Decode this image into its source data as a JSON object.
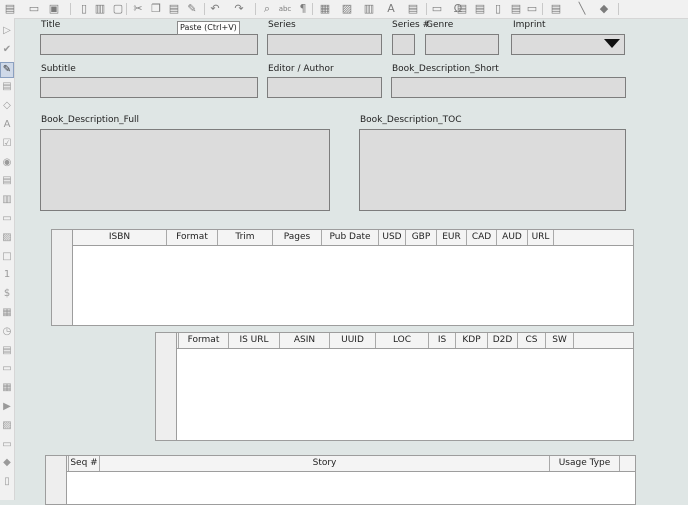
{
  "toolbar": {
    "icons": [
      {
        "name": "new-document-icon",
        "glyph": "▤"
      },
      {
        "name": "open-folder-icon",
        "glyph": "▭"
      },
      {
        "name": "save-icon",
        "glyph": "▣"
      },
      {
        "name": "export-pdf-icon",
        "glyph": "▯"
      },
      {
        "name": "print-icon",
        "glyph": "▥"
      },
      {
        "name": "print-preview-icon",
        "glyph": "▢"
      },
      {
        "name": "cut-icon",
        "glyph": "✂"
      },
      {
        "name": "copy-icon",
        "glyph": "❐"
      },
      {
        "name": "paste-icon",
        "glyph": "▤"
      },
      {
        "name": "clone-formatting-icon",
        "glyph": "✎"
      },
      {
        "name": "undo-icon",
        "glyph": "↶"
      },
      {
        "name": "redo-icon",
        "glyph": "↷"
      },
      {
        "name": "find-replace-icon",
        "glyph": "⌕"
      },
      {
        "name": "spellcheck-icon",
        "glyph": "abc"
      },
      {
        "name": "formatting-marks-icon",
        "glyph": "¶"
      },
      {
        "name": "insert-table-icon",
        "glyph": "▦"
      },
      {
        "name": "insert-image-icon",
        "glyph": "▨"
      },
      {
        "name": "insert-chart-icon",
        "glyph": "▥"
      },
      {
        "name": "insert-textbox-icon",
        "glyph": "A"
      },
      {
        "name": "insert-page-break-icon",
        "glyph": "▤"
      },
      {
        "name": "insert-field-icon",
        "glyph": "▭"
      },
      {
        "name": "special-character-icon",
        "glyph": "Ω"
      },
      {
        "name": "hyperlink-icon",
        "glyph": "⊕"
      },
      {
        "name": "footnote-icon",
        "glyph": "▤"
      },
      {
        "name": "endnote-icon",
        "glyph": "▤"
      },
      {
        "name": "bookmark-icon",
        "glyph": "▯"
      },
      {
        "name": "cross-reference-icon",
        "glyph": "▤"
      },
      {
        "name": "comment-icon",
        "glyph": "▭"
      },
      {
        "name": "track-changes-icon",
        "glyph": "▤"
      },
      {
        "name": "line-icon",
        "glyph": "╲"
      },
      {
        "name": "basic-shapes-icon",
        "glyph": "◆"
      }
    ]
  },
  "tooltip": {
    "text": "Paste (Ctrl+V)"
  },
  "sidebar": {
    "icons": [
      {
        "name": "select-pointer-icon",
        "glyph": "▷"
      },
      {
        "name": "design-mode-icon",
        "glyph": "✔"
      },
      {
        "name": "control-properties-icon",
        "glyph": "✎"
      },
      {
        "name": "form-properties-icon",
        "glyph": "▤"
      },
      {
        "name": "tab-order-icon",
        "glyph": "◇"
      },
      {
        "name": "label-field-icon",
        "glyph": "A"
      },
      {
        "name": "checkbox-icon",
        "glyph": "☑"
      },
      {
        "name": "option-button-icon",
        "glyph": "◉"
      },
      {
        "name": "list-box-icon",
        "glyph": "▤"
      },
      {
        "name": "combo-box-icon",
        "glyph": "▥"
      },
      {
        "name": "push-button-icon",
        "glyph": "▭"
      },
      {
        "name": "image-button-icon",
        "glyph": "▨"
      },
      {
        "name": "formatted-field-icon",
        "glyph": "□"
      },
      {
        "name": "numeric-field-icon",
        "glyph": "1"
      },
      {
        "name": "currency-field-icon",
        "glyph": "$"
      },
      {
        "name": "date-field-icon",
        "glyph": "▦"
      },
      {
        "name": "time-field-icon",
        "glyph": "◷"
      },
      {
        "name": "pattern-field-icon",
        "glyph": "▤"
      },
      {
        "name": "group-box-icon",
        "glyph": "▭"
      },
      {
        "name": "table-control-icon",
        "glyph": "▦"
      },
      {
        "name": "navigation-bar-icon",
        "glyph": "▶"
      },
      {
        "name": "image-control-icon",
        "glyph": "▨"
      },
      {
        "name": "file-selection-icon",
        "glyph": "▭"
      },
      {
        "name": "spin-button-icon",
        "glyph": "◆"
      },
      {
        "name": "scrollbar-icon",
        "glyph": "▯"
      }
    ]
  },
  "form": {
    "labels": {
      "title": "Title",
      "series": "Series",
      "series_num": "Series #",
      "genre": "Genre",
      "imprint": "Imprint",
      "subtitle": "Subtitle",
      "editor_author": "Editor / Author",
      "desc_short": "Book_Description_Short",
      "desc_full": "Book_Description_Full",
      "desc_toc": "Book_Description_TOC"
    },
    "values": {
      "title": "",
      "series": "",
      "series_num": "",
      "genre": "",
      "imprint": "",
      "subtitle": "",
      "editor_author": "",
      "desc_short": "",
      "desc_full": "",
      "desc_toc": ""
    }
  },
  "tables": {
    "editions": {
      "columns": [
        "ISBN",
        "Format",
        "Trim",
        "Pages",
        "Pub Date",
        "USD",
        "GBP",
        "EUR",
        "CAD",
        "AUD",
        "URL"
      ]
    },
    "formats": {
      "columns": [
        "Format",
        "IS URL",
        "ASIN",
        "UUID",
        "LOC",
        "IS",
        "KDP",
        "D2D",
        "CS",
        "SW"
      ]
    },
    "stories": {
      "columns": [
        "Seq #",
        "Story",
        "Usage Type"
      ]
    }
  }
}
